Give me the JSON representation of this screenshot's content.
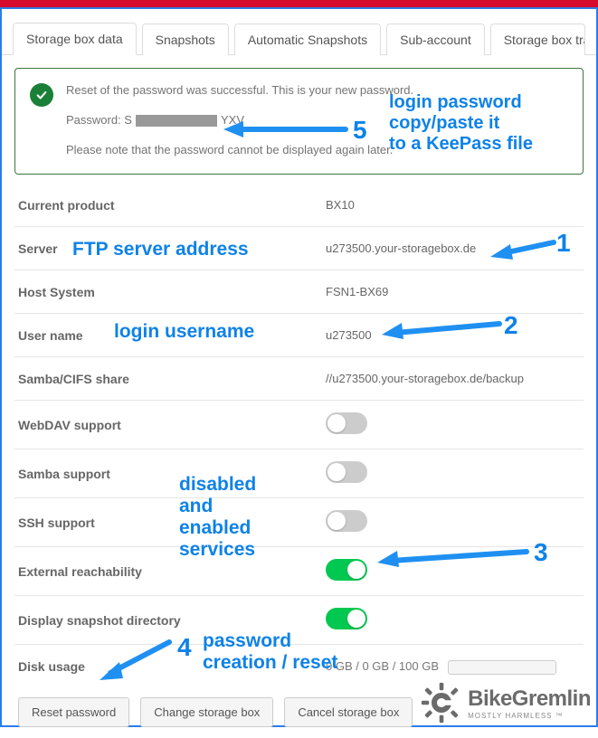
{
  "tabs": {
    "t0": "Storage box data",
    "t1": "Snapshots",
    "t2": "Automatic Snapshots",
    "t3": "Sub-account",
    "t4": "Storage box trans"
  },
  "alert": {
    "line1": "Reset of the password was successful. This is your new password.",
    "pw_label": "Password: S",
    "pw_suffix": "YXV",
    "line3": "Please note that the password cannot be displayed again later."
  },
  "rows": {
    "product_label": "Current product",
    "product_value": "BX10",
    "server_label": "Server",
    "server_value": "u273500.your-storagebox.de",
    "host_label": "Host System",
    "host_value": "FSN1-BX69",
    "user_label": "User name",
    "user_value": "u273500",
    "samba_label": "Samba/CIFS share",
    "samba_value": "//u273500.your-storagebox.de/backup",
    "webdav_label": "WebDAV support",
    "sambas_label": "Samba support",
    "ssh_label": "SSH support",
    "ext_label": "External reachability",
    "snap_label": "Display snapshot directory",
    "disk_label": "Disk usage",
    "disk_value": "0 GB / 0 GB / 100 GB"
  },
  "buttons": {
    "reset": "Reset password",
    "change": "Change storage box",
    "cancel": "Cancel storage box"
  },
  "annotations": {
    "a5_text": "login password\ncopy/paste it\nto a KeePass file",
    "a5_num": "5",
    "a1_text": "FTP server address",
    "a1_num": "1",
    "a2_text": "login username",
    "a2_num": "2",
    "a3_text": "disabled\nand\nenabled\nservices",
    "a3_num": "3",
    "a4_text": "password\ncreation / reset",
    "a4_num": "4"
  },
  "watermark": {
    "brand": "BikeGremlin",
    "tag": "MOSTLY HARMLESS ™"
  }
}
